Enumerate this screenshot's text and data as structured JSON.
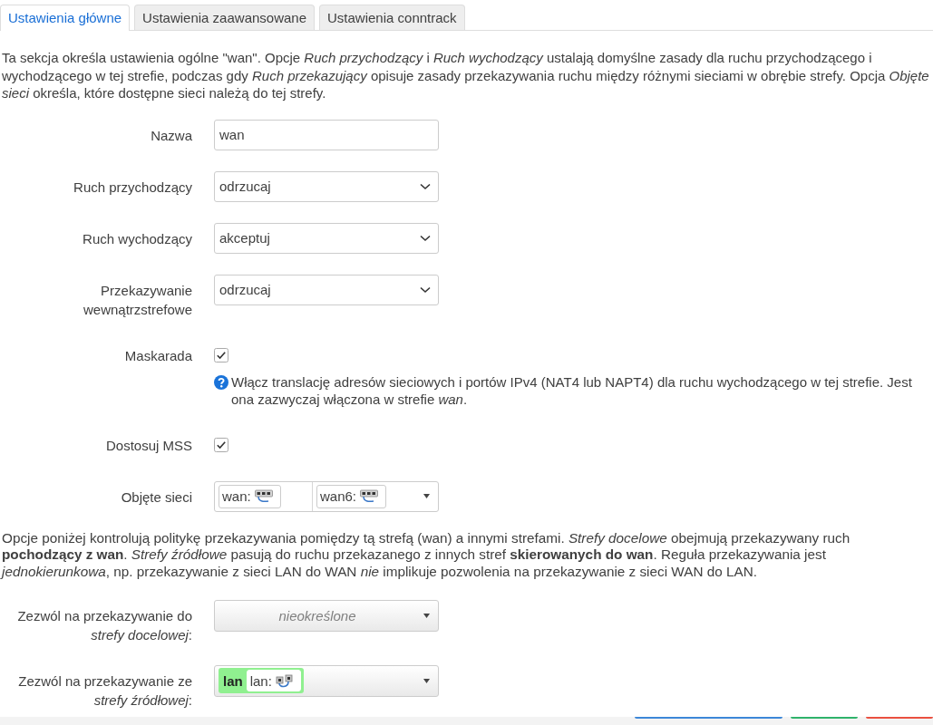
{
  "tabs": [
    {
      "label": "Ustawienia główne",
      "selected": true
    },
    {
      "label": "Ustawienia zaawansowane",
      "selected": false
    },
    {
      "label": "Ustawienia conntrack",
      "selected": false
    }
  ],
  "description": "Ta sekcja określa ustawienia ogólne \"wan\". Opcje *Ruch przychodzący* i *Ruch wychodzący* ustalają domyślne zasady dla ruchu przychodzącego i wychodzącego w tej strefie, podczas gdy *Ruch przekazujący* opisuje zasady przekazywania ruchu między różnymi sieciami w obrębie strefy. Opcja *Objęte sieci* określa, które dostępne sieci należą do tej strefy.",
  "fields": [
    {
      "kind": "text",
      "label": "Nazwa",
      "value": "wan"
    },
    {
      "kind": "select",
      "label": "Ruch przychodzący",
      "value": "odrzucaj"
    },
    {
      "kind": "select",
      "label": "Ruch wychodzący",
      "value": "akceptuj"
    },
    {
      "kind": "select",
      "label": "Przekazywanie wewnątrzstrefowe",
      "value": "odrzucaj"
    },
    {
      "kind": "checkbox",
      "label": "Maskarada",
      "checked": true,
      "help": "Włącz translację adresów sieciowych i portów IPv4 (NAT4 lub NAPT4) dla ruchu wychodzącego w tej strefie. Jest ona zazwyczaj włączona w strefie *wan*."
    },
    {
      "kind": "checkbox",
      "label": "Dostosuj MSS",
      "checked": true
    },
    {
      "kind": "network_list",
      "label": "Objęte sieci",
      "items": [
        {
          "name": "wan:"
        },
        {
          "name": "wan6:"
        }
      ]
    }
  ],
  "forwarding_note": "Opcje poniżej kontrolują politykę przekazywania pomiędzy tą strefą (wan) a innymi strefami. *Strefy docelowe* obejmują przekazywany ruch **pochodzący z wan**. *Strefy źródłowe* pasują do ruchu przekazanego z innych stref **skierowanych do wan**. Reguła przekazywania jest *jednokierunkowa*, np. przekazywanie z sieci LAN do WAN *nie* implikuje pozwolenia na przekazywanie z sieci WAN do LAN.",
  "forwarding_fields": [
    {
      "kind": "zone_select",
      "label": "Zezwól na przekazywanie do *strefy docelowej*:",
      "placeholder": "nieokreślone"
    },
    {
      "kind": "zone_select",
      "label": "Zezwól na przekazywanie ze *strefy źródłowej*:",
      "zones": [
        {
          "zone": "lan",
          "color": "#90f090",
          "networks": [
            {
              "name": "lan:"
            }
          ]
        }
      ]
    }
  ],
  "footer": {
    "buttons": [
      {
        "color": "#3c87d8"
      },
      {
        "color": "#2fb36b"
      },
      {
        "color": "#ea5040"
      }
    ]
  }
}
